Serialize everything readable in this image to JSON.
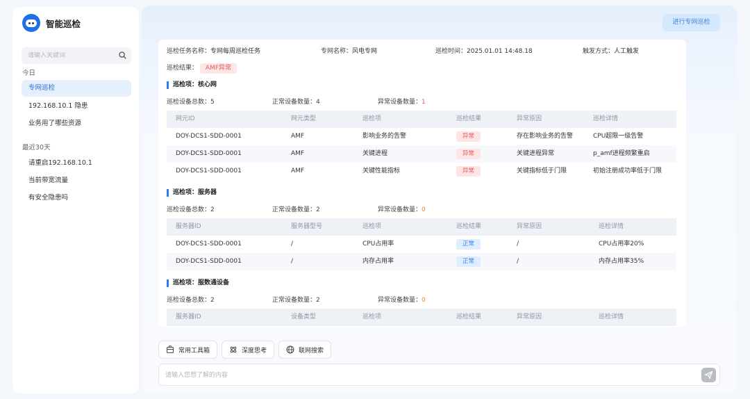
{
  "app": {
    "title": "智能巡检"
  },
  "search": {
    "placeholder": "请输入关键词"
  },
  "sidebar": {
    "groups": [
      {
        "label": "今日",
        "items": [
          "专网巡检",
          "192.168.10.1 隐患",
          "业务用了哪些资源"
        ]
      },
      {
        "label": "最近30天",
        "items": [
          "请重启192.168.10.1",
          "当前带宽流量",
          "有安全隐患吗"
        ]
      }
    ],
    "active_item": "专网巡检"
  },
  "header": {
    "action_button": "进行专网巡检"
  },
  "report": {
    "task_label": "巡检任务名称：",
    "task_value": "专网每周巡检任务",
    "net_label": "专网名称：",
    "net_value": "风电专网",
    "time_label": "巡检时间：",
    "time_value": "2025.01.01 14:48.18",
    "trigger_label": "触发方式：",
    "trigger_value": "人工触发",
    "result_label": "巡检结果：",
    "result_value": "AMF异常",
    "sections": [
      {
        "title": "巡检项：核心网",
        "total_label": "巡检设备总数：",
        "total": "5",
        "normal_label": "正常设备数量：",
        "normal": "4",
        "abnormal_label": "异常设备数量：",
        "abnormal": "1",
        "columns": [
          "网元ID",
          "网元类型",
          "巡检项",
          "巡检结果",
          "异常原因",
          "巡检详情"
        ],
        "rows": [
          [
            "DOY-DCS1-SDD-0001",
            "AMF",
            "影响业务的告警",
            "异常",
            "存在影响业务的告警",
            "CPU超限一级告警"
          ],
          [
            "DOY-DCS1-SDD-0001",
            "AMF",
            "关键进程",
            "异常",
            "关键进程异常",
            "p_amf进程频繁重启"
          ],
          [
            "DOY-DCS1-SDD-0001",
            "AMF",
            "关键性能指标",
            "异常",
            "关键指标低于门限",
            "初始注册成功率低于门限"
          ]
        ]
      },
      {
        "title": "巡检项：服务器",
        "total_label": "巡检设备总数：",
        "total": "2",
        "normal_label": "正常设备数量：",
        "normal": "2",
        "abnormal_label": "异常设备数量：",
        "abnormal": "0",
        "columns": [
          "服务器ID",
          "服务器型号",
          "巡检项",
          "巡检结果",
          "异常原因",
          "巡检详情"
        ],
        "rows": [
          [
            "DOY-DCS1-SDD-0001",
            "/",
            "CPU占用率",
            "正常",
            "/",
            "CPU占用率20%"
          ],
          [
            "DOY-DCS1-SDD-0001",
            "/",
            "内存占用率",
            "正常",
            "/",
            "内存占用率35%"
          ]
        ]
      },
      {
        "title": "巡检项：服数通设备",
        "total_label": "巡检设备总数：",
        "total": "2",
        "normal_label": "正常设备数量：",
        "normal": "2",
        "abnormal_label": "异常设备数量：",
        "abnormal": "0",
        "columns": [
          "服务器ID",
          "设备类型",
          "巡检项",
          "巡检结果",
          "异常原因",
          "巡检详情"
        ],
        "rows": []
      }
    ]
  },
  "tools": [
    "常用工具箱",
    "深度思考",
    "联网搜索"
  ],
  "chat": {
    "placeholder": "请输入您想了解的内容"
  },
  "colors": {
    "accent": "#2f7be8",
    "error": "#ea5a5a",
    "ok": "#3b84e6"
  }
}
